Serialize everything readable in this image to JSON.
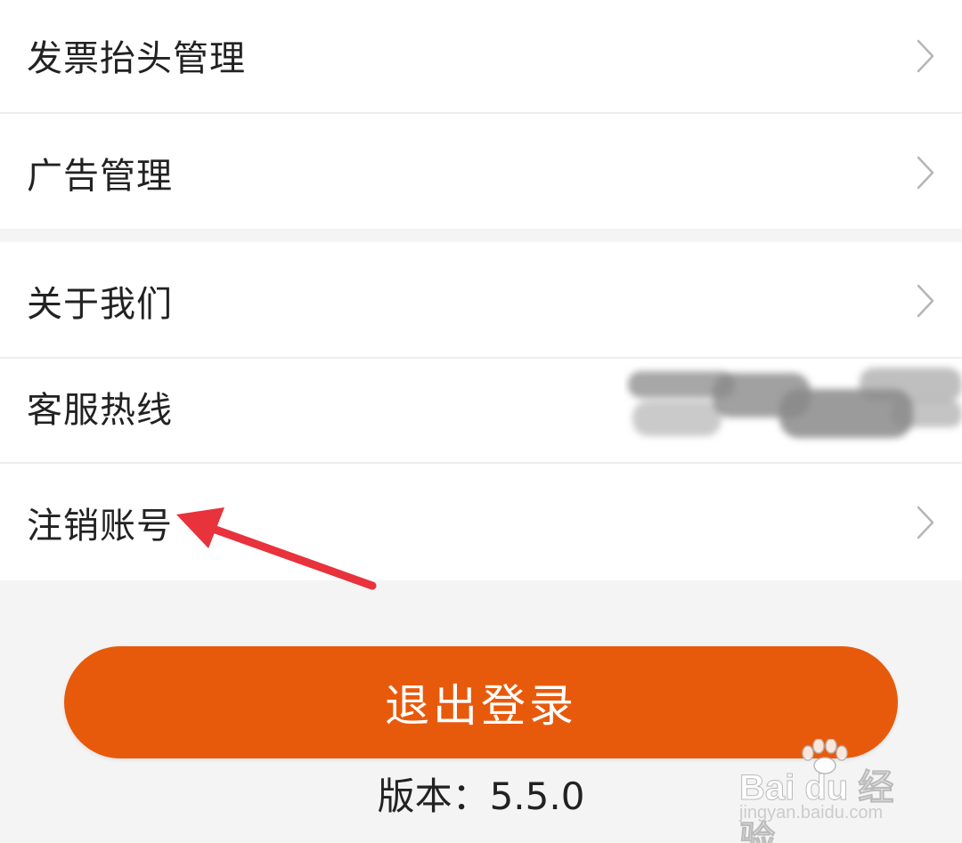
{
  "menu": {
    "group1": [
      {
        "label": "发票抬头管理"
      },
      {
        "label": "广告管理"
      }
    ],
    "group2": [
      {
        "label": "关于我们"
      },
      {
        "label": "客服热线"
      },
      {
        "label": "注销账号"
      }
    ]
  },
  "logout": {
    "label": "退出登录"
  },
  "version": {
    "text": "版本：5.5.0"
  },
  "watermark": {
    "text": "Bai du 经验",
    "sub": "jingyan.baidu.com"
  },
  "colors": {
    "accent": "#e85a0b",
    "annotation": "#e8323c"
  },
  "icons": {
    "row_chevron": "chevron-right-icon",
    "arrow": "red-arrow-icon"
  }
}
